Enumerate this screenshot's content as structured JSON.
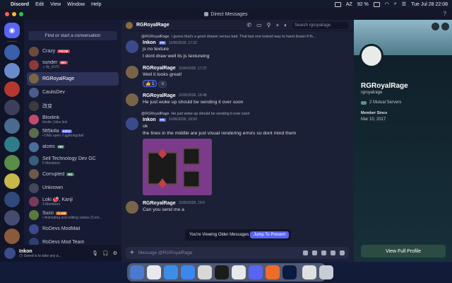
{
  "menubar": {
    "app": "Discord",
    "menus": [
      "Edit",
      "View",
      "Window",
      "Help"
    ],
    "battery": "92 %",
    "input_lang": "AZ",
    "clock": "Tue Jul 28  22:08"
  },
  "titlebar": {
    "title": "Direct Messages"
  },
  "sidebar": {
    "search_label": "Find or start a conversation",
    "items": [
      {
        "name": "Crazy",
        "tag": "FROM",
        "tag_color": "red",
        "sub": "",
        "avatar": "#6b4c3b"
      },
      {
        "name": "sunder",
        "tag": "MO",
        "tag_color": "red",
        "sub": "♫ 8y_EVO",
        "avatar": "#8a3a3a"
      },
      {
        "name": "RGRoyalRage",
        "tag": "",
        "tag_color": "",
        "sub": "",
        "avatar": "#7a6448",
        "active": true
      },
      {
        "name": "CaulisDev",
        "tag": "",
        "tag_color": "",
        "sub": "",
        "avatar": "#4d5b8c"
      },
      {
        "name": "改变",
        "tag": "",
        "tag_color": "",
        "sub": "",
        "avatar": "#3b3b3b"
      },
      {
        "name": "Bloxlink",
        "tag": "",
        "tag_color": "",
        "sub": "/invite | blox.link",
        "avatar": "#c24a6c"
      },
      {
        "name": "5ft5killa",
        "tag": "KRIG",
        "tag_color": "",
        "sub": "• DMs open // gg/kriegsfall",
        "avatar": "#5c6c4c"
      },
      {
        "name": "alceis",
        "tag": "HD",
        "tag_color": "green",
        "sub": "",
        "avatar": "#4a6f9a"
      },
      {
        "name": "Sell Technology Dev GC",
        "tag": "",
        "tag_color": "",
        "sub": "5 Members",
        "avatar": "#3a5e7a"
      },
      {
        "name": "Corrupted",
        "tag": "HD",
        "tag_color": "green",
        "sub": "",
        "avatar": "#6a5a4a"
      },
      {
        "name": "Unknown",
        "tag": "",
        "tag_color": "",
        "sub": "",
        "avatar": "#44475a"
      },
      {
        "name": "Loki 🥩, Kanji",
        "tag": "",
        "tag_color": "",
        "sub": "3 Members",
        "avatar": "#7a3a5a"
      },
      {
        "name": "Suco",
        "tag": "CLEB",
        "tag_color": "orange",
        "sub": "• Animating and editing videos (Com...",
        "avatar": "#5a7a3a"
      },
      {
        "name": "RoDevs ModMail",
        "tag": "",
        "tag_color": "",
        "sub": "",
        "avatar": "#3a4a8a"
      },
      {
        "name": "RoDevs Mod Team",
        "tag": "",
        "tag_color": "",
        "sub": "",
        "avatar": "#2f3f6f"
      }
    ]
  },
  "user_panel": {
    "name": "Inkon",
    "status": "😶 Greed is to take any a..."
  },
  "chat": {
    "recipient": "RGRoyalRage",
    "search_placeholder": "Search rgroyalrage",
    "messages": [
      {
        "type": "reply",
        "reply_who": "@RGRoyalRage",
        "reply_text": "I guess that's a good drawer versus bad. That last one looked way to hand drawn if th...",
        "author": "Inkon",
        "badge": "PR",
        "time": "11/06/2026, 17:32",
        "lines": [
          "js no texture",
          "I dont draw well its js textureing"
        ],
        "avatar": "#3a4b8c"
      },
      {
        "type": "normal",
        "author": "RGRoyalRage",
        "time": "11/06/2026, 17:37",
        "lines": [
          "Well it looks great!"
        ],
        "reaction": "👍 1",
        "avatar": "#7a6448"
      },
      {
        "type": "normal",
        "author": "RGRoyalRage",
        "time": "11/06/2026, 18:48",
        "lines": [
          "He just woke up should be sending it over soon"
        ],
        "avatar": "#7a6448"
      },
      {
        "type": "reply",
        "reply_who": "@RGRoyalRage",
        "reply_text": "He just woke up should be sending it over soon",
        "author": "Inkon",
        "badge": "PR",
        "time": "11/06/2026, 18:50",
        "lines": [
          "ok",
          "the lines in the middle are just visual rendering errors so dont mind them"
        ],
        "avatar": "#3a4b8c",
        "image": true
      },
      {
        "type": "normal",
        "author": "RGRoyalRage",
        "time": "11/06/2026, 19:0",
        "lines": [
          "Can you send me a"
        ],
        "avatar": "#7a6448"
      }
    ],
    "older_notice": "You're Viewing Older Messages",
    "jump_label": "Jump To Present",
    "composer_placeholder": "Message @RGRoyalRage"
  },
  "profile": {
    "name": "RGRoyalRage",
    "handle": "rgroyalrage",
    "mutual": "2 Mutual Servers",
    "member_since_label": "Member Since",
    "member_since": "Mar 10, 2017",
    "full_profile_label": "View Full Profile"
  },
  "colors": {
    "accent": "#5865f2",
    "rail_bg": "#111326",
    "sidebar_bg": "#161a33",
    "chat_bg": "#1b2036"
  }
}
